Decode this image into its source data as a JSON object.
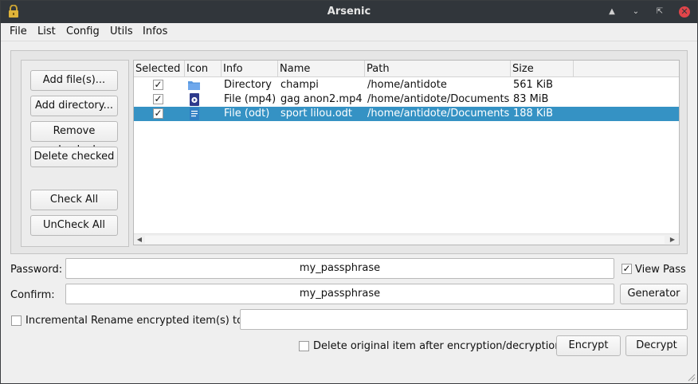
{
  "window": {
    "title": "Arsenic"
  },
  "menu": [
    "File",
    "List",
    "Config",
    "Utils",
    "Infos"
  ],
  "buttons": {
    "add_files": "Add file(s)...",
    "add_directory": "Add directory...",
    "remove_checked": "Remove checked",
    "delete_checked": "Delete checked",
    "check_all": "Check All",
    "uncheck_all": "UnCheck All",
    "generator": "Generator",
    "encrypt": "Encrypt",
    "decrypt": "Decrypt"
  },
  "table": {
    "columns": [
      "Selected",
      "Icon",
      "Info",
      "Name",
      "Path",
      "Size"
    ],
    "rows": [
      {
        "selected": true,
        "icon": "folder-icon",
        "info": "Directory",
        "name": "champi",
        "path": "/home/antidote",
        "size": "561 KiB"
      },
      {
        "selected": true,
        "icon": "video-file-icon",
        "info": "File (mp4)",
        "name": "gag anon2.mp4",
        "path": "/home/antidote/Documents",
        "size": "83 MiB"
      },
      {
        "selected": true,
        "icon": "document-file-icon",
        "info": "File (odt)",
        "name": "sport lilou.odt",
        "path": "/home/antidote/Documents",
        "size": "188 KiB",
        "highlighted": true
      }
    ]
  },
  "form": {
    "password_label": "Password:",
    "password_value": "my_passphrase",
    "confirm_label": "Confirm:",
    "confirm_value": "my_passphrase",
    "view_pass_label": "View Pass",
    "view_pass_checked": true,
    "incremental_label": "Incremental Rename encrypted item(s) to:",
    "incremental_checked": false,
    "incremental_value": "",
    "delete_original_label": "Delete original item after encryption/decryption",
    "delete_original_checked": false
  },
  "colors": {
    "selection": "#3592c4",
    "titlebar": "#31363b",
    "close": "#e0454a"
  }
}
